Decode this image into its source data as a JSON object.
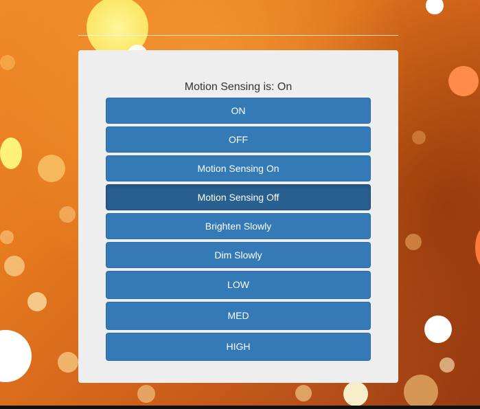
{
  "status": {
    "text": "Motion Sensing is: On"
  },
  "buttons": [
    {
      "label": "ON"
    },
    {
      "label": "OFF"
    },
    {
      "label": "Motion Sensing On"
    },
    {
      "label": "Motion Sensing Off"
    },
    {
      "label": "Brighten Slowly"
    },
    {
      "label": "Dim Slowly"
    },
    {
      "label": "LOW"
    },
    {
      "label": "MED"
    },
    {
      "label": "HIGH"
    }
  ],
  "colors": {
    "button_primary": "#337ab7",
    "button_active": "#286090",
    "panel": "#eeeeee",
    "background_accent": "#e57a1f"
  }
}
